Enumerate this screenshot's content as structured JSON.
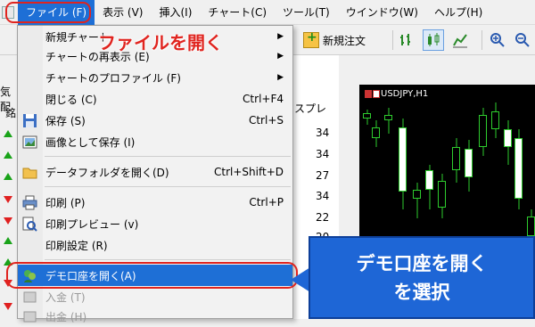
{
  "menubar": {
    "items": [
      "ファイル (F)",
      "表示 (V)",
      "挿入(I)",
      "チャート(C)",
      "ツール(T)",
      "ウインドウ(W)",
      "ヘルプ(H)"
    ]
  },
  "toolbar": {
    "new_order": "新規注文"
  },
  "left_panel": {
    "labels": [
      "気配",
      "銘"
    ],
    "spread_header": "スプレ",
    "spreads": [
      "34",
      "34",
      "27",
      "34",
      "22",
      "20"
    ]
  },
  "chart": {
    "title": "USDJPY,H1",
    "accent": "#2ecc2e"
  },
  "dropdown": {
    "items": [
      {
        "label": "新規チャート",
        "shortcut": "",
        "submenu": true
      },
      {
        "label": "チャートの再表示 (E)",
        "shortcut": "",
        "submenu": true
      },
      {
        "label": "チャートのプロファイル (F)",
        "shortcut": "",
        "submenu": true
      },
      {
        "label": "閉じる (C)",
        "shortcut": "Ctrl+F4",
        "submenu": false
      },
      {
        "label": "保存 (S)",
        "shortcut": "Ctrl+S",
        "submenu": false
      },
      {
        "label": "画像として保存 (I)",
        "shortcut": "",
        "submenu": false
      },
      {
        "label": "データフォルダを開く(D)",
        "shortcut": "Ctrl+Shift+D",
        "submenu": false
      },
      {
        "label": "印刷 (P)",
        "shortcut": "Ctrl+P",
        "submenu": false
      },
      {
        "label": "印刷プレビュー (v)",
        "shortcut": "",
        "submenu": false
      },
      {
        "label": "印刷設定 (R)",
        "shortcut": "",
        "submenu": false
      },
      {
        "label": "デモ口座を開く(A)",
        "shortcut": "",
        "submenu": false
      },
      {
        "label": "入金 (T)",
        "shortcut": "",
        "submenu": false
      },
      {
        "label": "出金 (H)",
        "shortcut": "",
        "submenu": false
      }
    ]
  },
  "annotations": {
    "open_file": "ファイルを開く",
    "callout_line1": "デモ口座を開く",
    "callout_line2": "を選択"
  },
  "colors": {
    "highlight": "#1e6fd6",
    "annotation_red": "#e0241f",
    "callout_blue": "#1e66d6"
  }
}
